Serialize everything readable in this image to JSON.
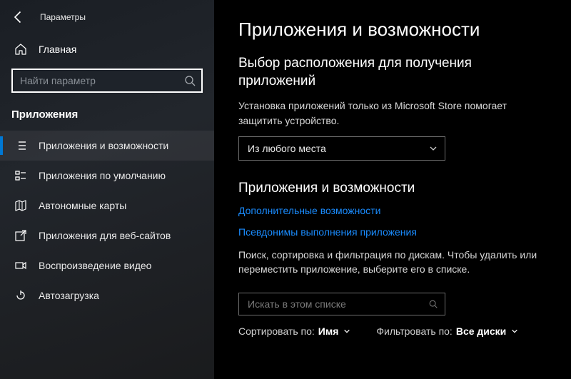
{
  "window": {
    "title": "Параметры"
  },
  "sidebar": {
    "home_label": "Главная",
    "search_placeholder": "Найти параметр",
    "group_label": "Приложения",
    "items": [
      {
        "label": "Приложения и возможности"
      },
      {
        "label": "Приложения по умолчанию"
      },
      {
        "label": "Автономные карты"
      },
      {
        "label": "Приложения для веб-сайтов"
      },
      {
        "label": "Воспроизведение видео"
      },
      {
        "label": "Автозагрузка"
      }
    ]
  },
  "main": {
    "title": "Приложения и возможности",
    "install_section": {
      "heading": "Выбор расположения для получения приложений",
      "helper": "Установка приложений только из Microsoft Store помогает защитить устройство.",
      "dropdown_value": "Из любого места"
    },
    "apps_section": {
      "heading": "Приложения и возможности",
      "link_optional": "Дополнительные возможности",
      "link_aliases": "Псевдонимы выполнения приложения",
      "helper": "Поиск, сортировка и фильтрация по дискам. Чтобы удалить или переместить приложение, выберите его в списке.",
      "search_placeholder": "Искать в этом списке",
      "sort_label": "Сортировать по:",
      "sort_value": "Имя",
      "filter_label": "Фильтровать по:",
      "filter_value": "Все диски"
    }
  }
}
